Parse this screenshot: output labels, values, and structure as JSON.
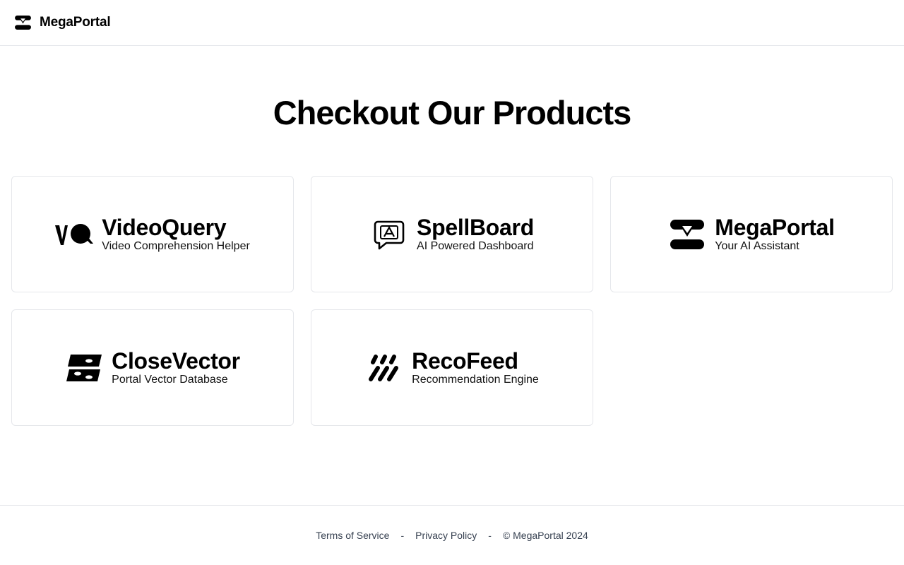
{
  "header": {
    "brand_name": "MegaPortal",
    "logo_icon": "megaportal-logo-icon"
  },
  "main": {
    "title": "Checkout Our Products",
    "products": [
      {
        "name": "VideoQuery",
        "subtitle": "Video Comprehension Helper",
        "icon": "videoquery-logo-icon"
      },
      {
        "name": "SpellBoard",
        "subtitle": "AI Powered Dashboard",
        "icon": "spellboard-logo-icon"
      },
      {
        "name": "MegaPortal",
        "subtitle": "Your AI Assistant",
        "icon": "megaportal-logo-icon"
      },
      {
        "name": "CloseVector",
        "subtitle": "Portal Vector Database",
        "icon": "closevector-logo-icon"
      },
      {
        "name": "RecoFeed",
        "subtitle": "Recommendation Engine",
        "icon": "recofeed-logo-icon"
      }
    ]
  },
  "footer": {
    "terms_label": "Terms of Service",
    "separator": "-",
    "privacy_label": "Privacy Policy",
    "copyright": "© MegaPortal 2024"
  },
  "colors": {
    "border": "#e5e7eb",
    "text": "#000000",
    "footer_text": "#374151"
  }
}
